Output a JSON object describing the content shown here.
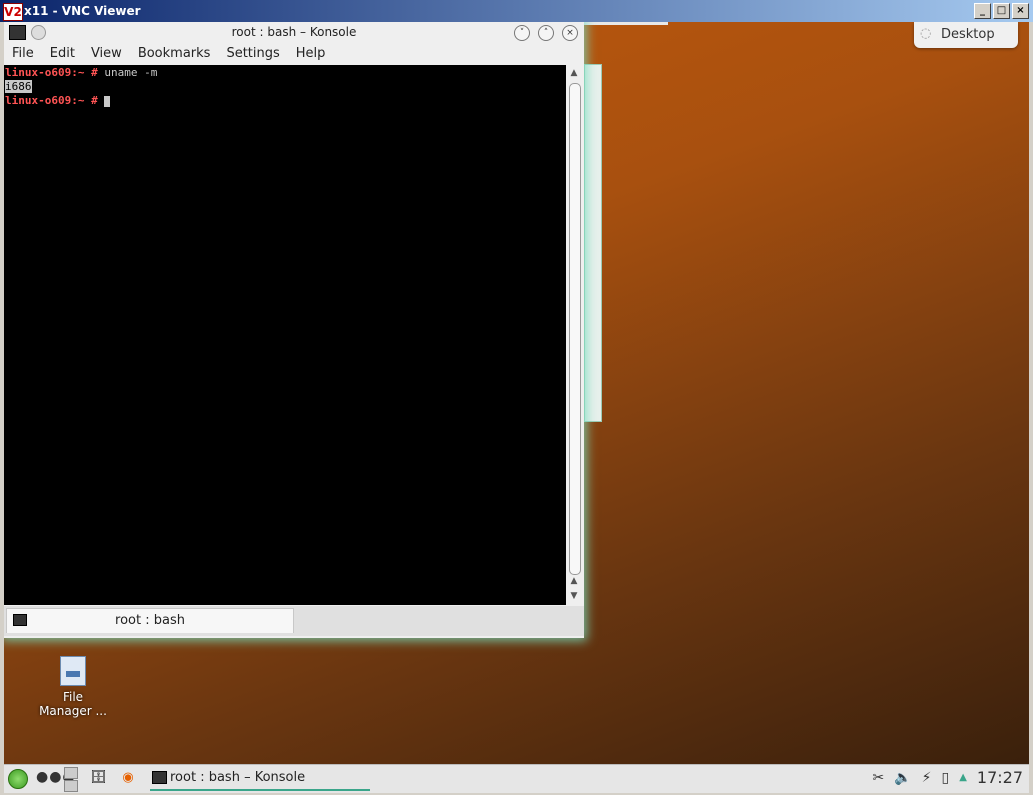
{
  "vnc": {
    "logo": "V2",
    "title": "x11 - VNC Viewer",
    "minimize": "_",
    "maximize": "□",
    "close": "×"
  },
  "desktop": {
    "button_label": "Desktop",
    "file_manager_label_1": "File",
    "file_manager_label_2": "Manager ..."
  },
  "konsole": {
    "title": "root : bash – Konsole",
    "menu": [
      "File",
      "Edit",
      "View",
      "Bookmarks",
      "Settings",
      "Help"
    ],
    "terminal": {
      "prompt": "linux-o609:~ #",
      "command": " uname -m",
      "output": "i686",
      "prompt2": "linux-o609:~ #"
    },
    "tab_label": "root : bash"
  },
  "taskbar": {
    "task_label": "root : bash – Konsole",
    "clock": "17:27"
  }
}
